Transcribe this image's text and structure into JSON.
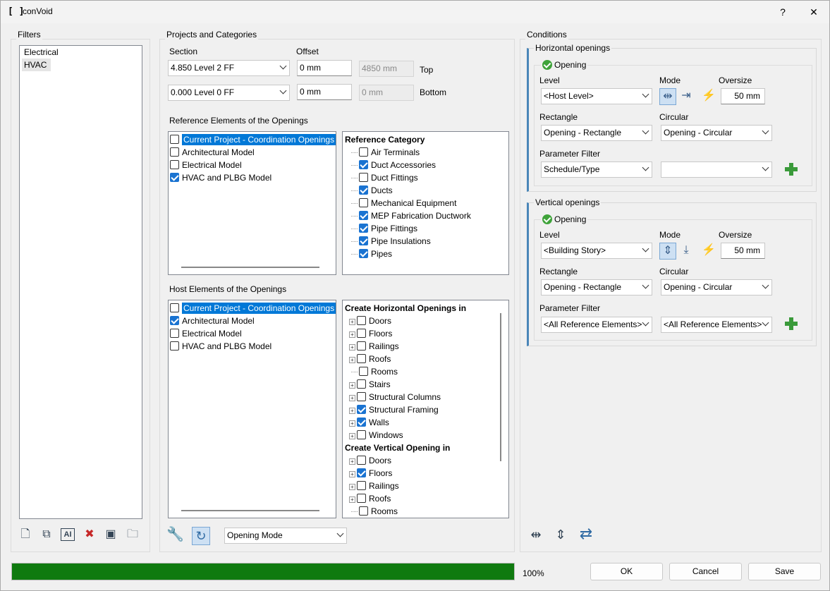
{
  "window": {
    "title": "conVoid",
    "help_label": "?",
    "close_label": "✕"
  },
  "filters": {
    "label": "Filters",
    "items": [
      "Electrical",
      "HVAC"
    ]
  },
  "projects": {
    "label": "Projects and Categories",
    "section_label": "Section",
    "offset_label": "Offset",
    "top": {
      "section": "4.850  Level 2 FF",
      "offset": "0 mm",
      "computed": "4850 mm",
      "label": "Top"
    },
    "bottom": {
      "section": "0.000  Level 0 FF",
      "offset": "0 mm",
      "computed": "0 mm",
      "label": "Bottom"
    },
    "reference_label": "Reference Elements of the Openings",
    "reference_models": [
      {
        "label": "Current Project - Coordination Openings",
        "checked": false,
        "selected": true
      },
      {
        "label": "Architectural Model",
        "checked": false,
        "selected": false
      },
      {
        "label": "Electrical Model",
        "checked": false,
        "selected": false
      },
      {
        "label": "HVAC and PLBG Model",
        "checked": true,
        "selected": false
      }
    ],
    "reference_category_head": "Reference Category",
    "reference_categories": [
      {
        "label": "Air Terminals",
        "checked": false
      },
      {
        "label": "Duct Accessories",
        "checked": true
      },
      {
        "label": "Duct Fittings",
        "checked": false
      },
      {
        "label": "Ducts",
        "checked": true
      },
      {
        "label": "Mechanical Equipment",
        "checked": false
      },
      {
        "label": "MEP Fabrication Ductwork",
        "checked": true
      },
      {
        "label": "Pipe Fittings",
        "checked": true
      },
      {
        "label": "Pipe Insulations",
        "checked": true
      },
      {
        "label": "Pipes",
        "checked": true
      }
    ],
    "host_label": "Host Elements of the Openings",
    "host_models": [
      {
        "label": "Current Project - Coordination Openings",
        "checked": false,
        "selected": true
      },
      {
        "label": "Architectural Model",
        "checked": true,
        "selected": false
      },
      {
        "label": "Electrical Model",
        "checked": false,
        "selected": false
      },
      {
        "label": "HVAC and PLBG Model",
        "checked": false,
        "selected": false
      }
    ],
    "horizontal_head": "Create Horizontal Openings in",
    "horizontal_items": [
      {
        "label": "Doors",
        "checked": false,
        "expand": true
      },
      {
        "label": "Floors",
        "checked": false,
        "expand": true
      },
      {
        "label": "Railings",
        "checked": false,
        "expand": true
      },
      {
        "label": "Roofs",
        "checked": false,
        "expand": true
      },
      {
        "label": "Rooms",
        "checked": false,
        "expand": false
      },
      {
        "label": "Stairs",
        "checked": false,
        "expand": true
      },
      {
        "label": "Structural Columns",
        "checked": false,
        "expand": true
      },
      {
        "label": "Structural Framing",
        "checked": true,
        "expand": true
      },
      {
        "label": "Walls",
        "checked": true,
        "expand": true
      },
      {
        "label": "Windows",
        "checked": false,
        "expand": true
      }
    ],
    "vertical_head": "Create Vertical Opening in",
    "vertical_items": [
      {
        "label": "Doors",
        "checked": false,
        "expand": true
      },
      {
        "label": "Floors",
        "checked": true,
        "expand": true
      },
      {
        "label": "Railings",
        "checked": false,
        "expand": true
      },
      {
        "label": "Roofs",
        "checked": false,
        "expand": true
      },
      {
        "label": "Rooms",
        "checked": false,
        "expand": false
      }
    ],
    "mode_select": "Opening Mode"
  },
  "conditions": {
    "label": "Conditions",
    "horizontal": {
      "title": "Horizontal openings",
      "opening_label": "Opening",
      "level_label": "Level",
      "mode_label": "Mode",
      "oversize_label": "Oversize",
      "level": "<Host Level>",
      "oversize": "50 mm",
      "rectangle_label": "Rectangle",
      "circular_label": "Circular",
      "rectangle": "Opening - Rectangle",
      "circular": "Opening - Circular",
      "param_label": "Parameter Filter",
      "param_1": "Schedule/Type",
      "param_2": ""
    },
    "vertical": {
      "title": "Vertical openings",
      "opening_label": "Opening",
      "level_label": "Level",
      "mode_label": "Mode",
      "oversize_label": "Oversize",
      "level": "<Building Story>",
      "oversize": "50 mm",
      "rectangle_label": "Rectangle",
      "circular_label": "Circular",
      "rectangle": "Opening - Rectangle",
      "circular": "Opening - Circular",
      "param_label": "Parameter Filter",
      "param_1": "<All Reference Elements>",
      "param_2": "<All Reference Elements>"
    }
  },
  "footer": {
    "progress": 1.0,
    "progress_label": "100%",
    "ok": "OK",
    "cancel": "Cancel",
    "save": "Save"
  }
}
